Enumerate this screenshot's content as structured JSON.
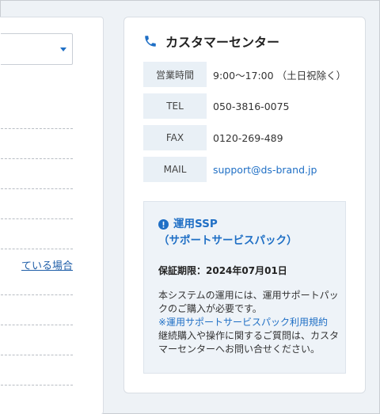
{
  "left_panel": {
    "link_text": "ている場合"
  },
  "contact": {
    "title": "カスタマーセンター",
    "rows": [
      {
        "label": "営業時間",
        "value": "9:00～17:00 （土日祝除く）"
      },
      {
        "label": "TEL",
        "value": "050-3816-0075"
      },
      {
        "label": "FAX",
        "value": "0120-269-489"
      },
      {
        "label": "MAIL",
        "value": "support@ds-brand.jp"
      }
    ]
  },
  "ssp": {
    "title_line1": "運用SSP",
    "title_line2": "（サポートサービスパック）",
    "period": "保証期限：2024年07月01日",
    "body_line1": "本システムの運用には、運用サポートパックのご購入が必要です。",
    "link_text": "※運用サポートサービスパック利用規約",
    "body_line2": "継続購入や操作に関するご質問は、カスタマーセンターへお問い合せください。"
  },
  "colors": {
    "accent": "#1f6fc5",
    "label_bg": "#e9f0f6",
    "page_bg": "#eef2f6"
  }
}
